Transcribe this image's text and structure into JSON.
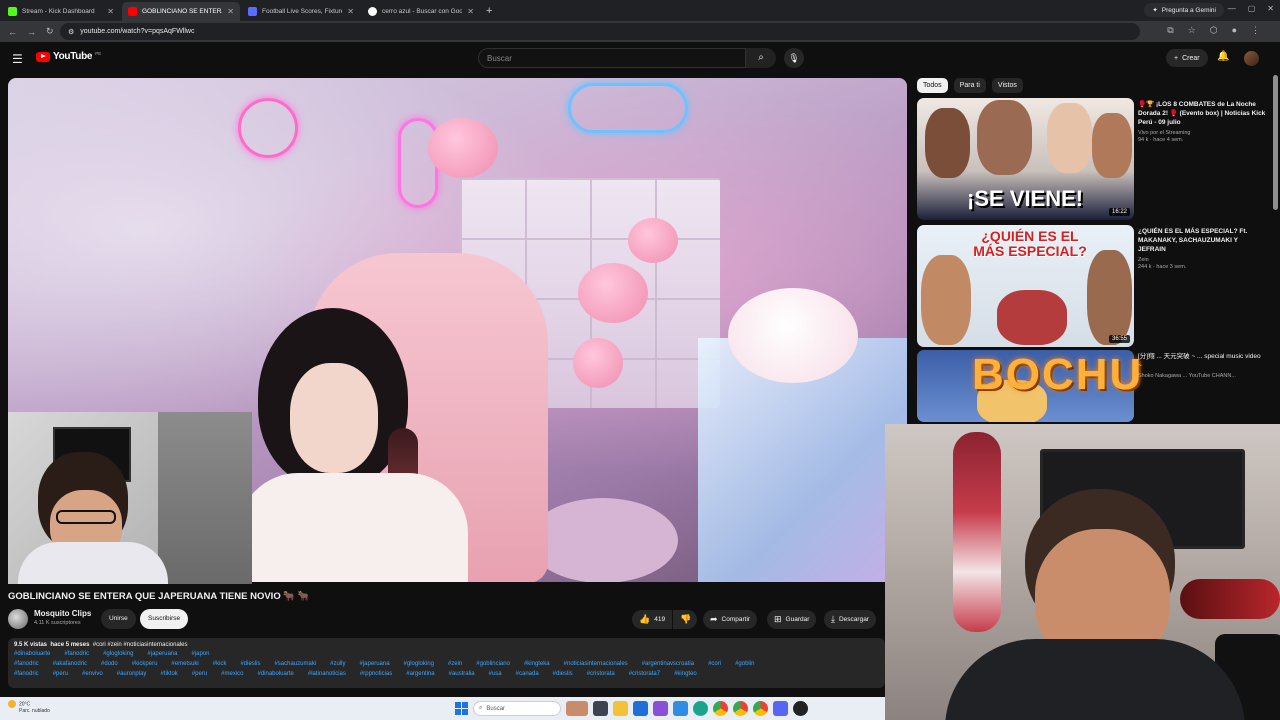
{
  "browser": {
    "tabs": [
      {
        "title": "Stream - Kick Dashboard",
        "color": "#53fc18",
        "active": false
      },
      {
        "title": "GOBLINCIANO SE ENTERA",
        "color": "#ff0000",
        "active": true
      },
      {
        "title": "Football Live Scores, Fixtures &",
        "color": "#5a6cff",
        "active": false
      },
      {
        "title": "cerro azul - Buscar con Google",
        "color": "#ffffff",
        "active": false
      }
    ],
    "url": "youtube.com/watch?v=pqsAqFWllwc",
    "gemini_label": "Pregunta a Gemini"
  },
  "yt": {
    "logo_text": "YouTube",
    "country_code": "PE",
    "search_placeholder": "Buscar",
    "create_label": "Crear"
  },
  "filters": [
    "Todos",
    "Para ti",
    "Vistos"
  ],
  "recommendations": [
    {
      "title": "🥊🏆 ¡LOS 8 COMBATES de La Noche Dorada 2! 🥊 (Evento box) | Noticias Kick Perú - 09 julio",
      "channel": "Vivo por el Streaming",
      "stats": "94 k · hace 4 sem.",
      "duration": "16:22",
      "thumb_text": "¡SE VIENE!"
    },
    {
      "title": "¿QUIÉN ES EL MÁS ESPECIAL? Ft. MAKANAKY, SACHAUZUMAKI Y JEFRAIN",
      "channel": "Zein",
      "stats": "244 k · hace 3 sem.",
      "duration": "36:55",
      "thumb_text": "¿QUIÉN ES EL MÁS ESPECIAL?"
    },
    {
      "title": "[分]翔 ... 天元突破 ~ ... special music video ~",
      "channel": "Shoko Nakagawa ... YouTube CHANN...",
      "stats": "",
      "duration": "",
      "thumb_text": "BOCHU"
    }
  ],
  "video": {
    "title": "GOBLINCIANO SE ENTERA QUE JAPERUANA TIENE NOVIO 🐂 🐂",
    "channel": "Mosquito Clips",
    "subscribers": "4.11 K suscriptores",
    "join_label": "Unirse",
    "subscribe_label": "Suscribirse",
    "likes": "419",
    "share_label": "Compartir",
    "save_label": "Guardar",
    "download_label": "Descargar",
    "views": "9.5 K vistas",
    "age": "hace 5 meses",
    "top_tags": "#cori #zein #noticiasinternacionales",
    "tag_rows": [
      [
        "#dinaboluarte",
        "#fanodric",
        "#glogloking",
        "#japeruana",
        "#japon"
      ],
      [
        "#fanodric",
        "#akafanodric",
        "#dodo",
        "#kickperu",
        "#emetsuki",
        "#kick",
        "#dieslis",
        "#sachauzumaki",
        "#zully",
        "#japeruana",
        "#glogloking",
        "#zein",
        "#goblinciano",
        "#kingteka",
        "#noticiasinternacionales",
        "#argentinavscroatia",
        "#cori",
        "#goblin"
      ],
      [
        "#fanodric",
        "#peru",
        "#envivo",
        "#auronplay",
        "#tiktok",
        "#peru",
        "#mexico",
        "#dinaboluarte",
        "#latinanoticias",
        "#rppnoticias",
        "#argentina",
        "#australia",
        "#usa",
        "#canada",
        "#dieslis",
        "#cristorata",
        "#cristorata7",
        "#kingteo"
      ]
    ]
  },
  "taskbar": {
    "weather_temp": "20°C",
    "weather_desc": "Parc. nublado",
    "search_label": "Buscar"
  }
}
